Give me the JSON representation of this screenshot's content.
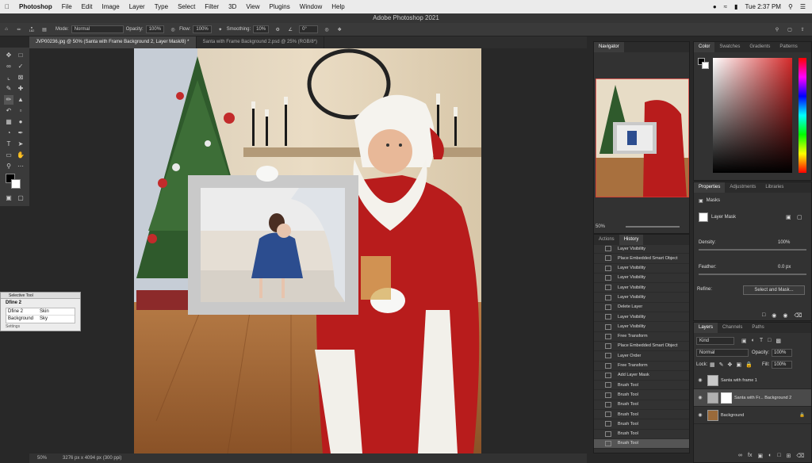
{
  "menubar": {
    "app": "Photoshop",
    "items": [
      "File",
      "Edit",
      "Image",
      "Layer",
      "Type",
      "Select",
      "Filter",
      "3D",
      "View",
      "Plugins",
      "Window",
      "Help"
    ],
    "clock": "Tue 2:37 PM"
  },
  "title": "Adobe Photoshop 2021",
  "options": {
    "brush_size": "182",
    "mode_label": "Mode:",
    "mode": "Normal",
    "opacity_label": "Opacity:",
    "opacity": "100%",
    "flow_label": "Flow:",
    "flow": "100%",
    "smoothing_label": "Smoothing:",
    "smoothing": "10%",
    "angle": "0°"
  },
  "tabs": [
    "JVP00236.jpg @ 50% (Santa with Frame Background 2, Layer Mask/8) *",
    "Santa with Frame Background 2.psd @ 25% (RGB/8*)"
  ],
  "status": {
    "zoom": "50%",
    "size": "3276 px x 4094 px (300 ppi)"
  },
  "navigator": {
    "title": "Navigator",
    "zoom": "50%"
  },
  "history": {
    "tabs": [
      "Actions",
      "History"
    ],
    "items": [
      "Layer Visibility",
      "Place Embedded Smart Object",
      "Layer Visibility",
      "Layer Visibility",
      "Layer Visibility",
      "Layer Visibility",
      "Delete Layer",
      "Layer Visibility",
      "Layer Visibility",
      "Free Transform",
      "Place Embedded Smart Object",
      "Layer Order",
      "Free Transform",
      "Add Layer Mask",
      "Brush Tool",
      "Brush Tool",
      "Brush Tool",
      "Brush Tool",
      "Brush Tool",
      "Brush Tool",
      "Brush Tool"
    ]
  },
  "color": {
    "tabs": [
      "Color",
      "Swatches",
      "Gradients",
      "Patterns"
    ],
    "hue_color": "#d42a2a"
  },
  "properties": {
    "tabs": [
      "Properties",
      "Adjustments",
      "Libraries"
    ],
    "section": "Masks",
    "mask_label": "Layer Mask",
    "density_label": "Density:",
    "density": "100%",
    "feather_label": "Feather:",
    "feather": "0.0 px",
    "refine_label": "Refine:",
    "select_mask": "Select and Mask..."
  },
  "layers": {
    "tabs": [
      "Layers",
      "Channels",
      "Paths"
    ],
    "kind": "Kind",
    "blend": "Normal",
    "opacity_label": "Opacity:",
    "opacity": "100%",
    "lock_label": "Lock:",
    "fill_label": "Fill:",
    "fill": "100%",
    "items": [
      "Santa with frame 1",
      "Santa with Fr... Background 2",
      "Background"
    ]
  },
  "selective": {
    "title": "Selective Tool",
    "heading": "Dfine 2",
    "rows": [
      [
        "Dfine 2",
        "Skin"
      ],
      [
        "Background",
        "Sky"
      ]
    ],
    "settings": "Settings"
  }
}
